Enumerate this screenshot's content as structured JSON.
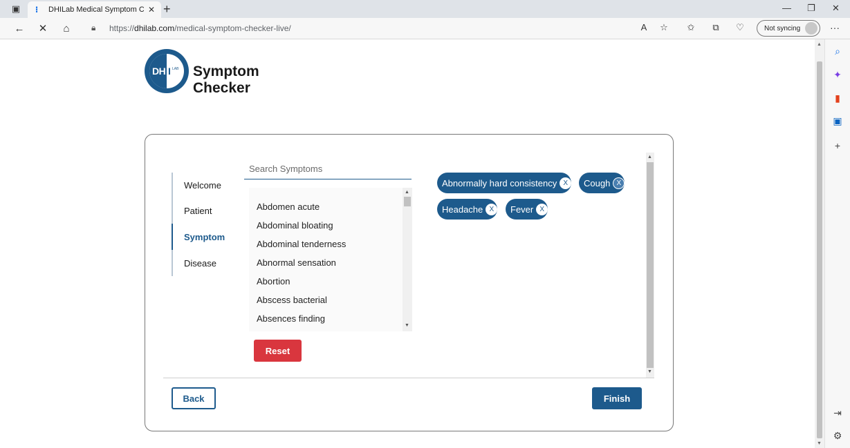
{
  "browser": {
    "tab_title": "DHILab Medical Symptom Checker",
    "url_prefix": "https://",
    "url_domain": "dhilab.com",
    "url_path": "/medical-symptom-checker-live/",
    "sync_label": "Not syncing"
  },
  "brand": {
    "line1": "Symptom",
    "line2": "Checker",
    "logo_left": "DH",
    "logo_right": "I",
    "logo_small": "LAB"
  },
  "steps": [
    {
      "label": "Welcome",
      "active": false
    },
    {
      "label": "Patient",
      "active": false
    },
    {
      "label": "Symptom",
      "active": true
    },
    {
      "label": "Disease",
      "active": false
    }
  ],
  "search": {
    "placeholder": "Search Symptoms",
    "value": ""
  },
  "symptom_list": [
    "Abdomen acute",
    "Abdominal bloating",
    "Abdominal tenderness",
    "Abnormal sensation",
    "Abortion",
    "Abscess bacterial",
    "Absences finding"
  ],
  "selected_symptoms": [
    {
      "label": "Abnormally hard consistency",
      "remove": "X"
    },
    {
      "label": "Cough",
      "remove": "X"
    },
    {
      "label": "Headache",
      "remove": "X"
    },
    {
      "label": "Fever",
      "remove": "X"
    }
  ],
  "buttons": {
    "reset": "Reset",
    "back": "Back",
    "finish": "Finish"
  },
  "colors": {
    "primary": "#1d5a8c",
    "reset": "#d9363e"
  }
}
